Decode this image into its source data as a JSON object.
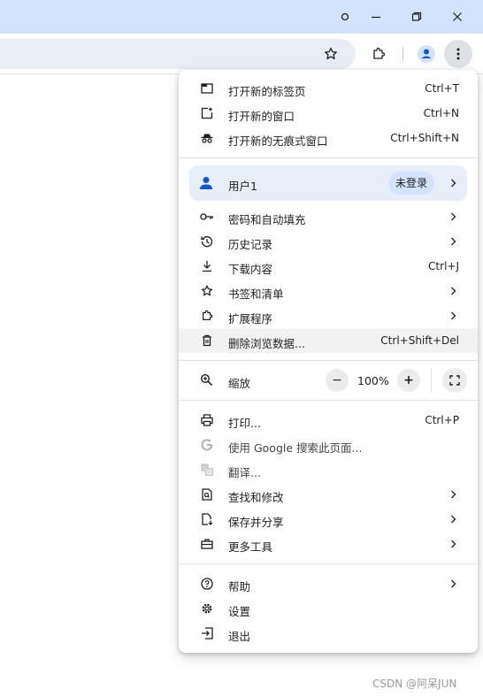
{
  "menu": {
    "new_items": [
      {
        "label": "打开新的标签页",
        "shortcut": "Ctrl+T",
        "icon": "new-tab-icon"
      },
      {
        "label": "打开新的窗口",
        "shortcut": "Ctrl+N",
        "icon": "new-window-icon"
      },
      {
        "label": "打开新的无痕式窗口",
        "shortcut": "Ctrl+Shift+N",
        "icon": "incognito-icon"
      }
    ],
    "profile": {
      "name": "用户1",
      "status": "未登录",
      "icon": "person-icon"
    },
    "group2": [
      {
        "label": "密码和自动填充",
        "icon": "key-icon"
      },
      {
        "label": "历史记录",
        "icon": "history-icon"
      },
      {
        "label": "下载内容",
        "shortcut": "Ctrl+J",
        "icon": "download-icon"
      },
      {
        "label": "书签和清单",
        "icon": "star-icon"
      },
      {
        "label": "扩展程序",
        "icon": "extension-icon"
      },
      {
        "label": "删除浏览数据...",
        "shortcut": "Ctrl+Shift+Del",
        "icon": "trash-icon"
      }
    ],
    "zoom": {
      "label": "缩放",
      "value": "100%",
      "minus": "−",
      "plus": "+"
    },
    "group3": [
      {
        "label": "打印...",
        "shortcut": "Ctrl+P",
        "icon": "print-icon"
      },
      {
        "label": "使用 Google 搜索此页面...",
        "icon": "google-icon"
      },
      {
        "label": "翻译...",
        "icon": "translate-icon"
      },
      {
        "label": "查找和修改",
        "icon": "find-icon"
      },
      {
        "label": "保存并分享",
        "icon": "save-share-icon"
      },
      {
        "label": "更多工具",
        "icon": "toolbox-icon"
      }
    ],
    "group4": [
      {
        "label": "帮助",
        "icon": "help-icon"
      },
      {
        "label": "设置",
        "icon": "settings-icon"
      },
      {
        "label": "退出",
        "icon": "exit-icon"
      }
    ]
  },
  "watermark": "CSDN @阿呆JUN",
  "colors": {
    "titlebar": "#d3e3fd",
    "omnibox": "#e9eef6",
    "accent": "#0b57d0",
    "badge": "#d3e3fd"
  }
}
